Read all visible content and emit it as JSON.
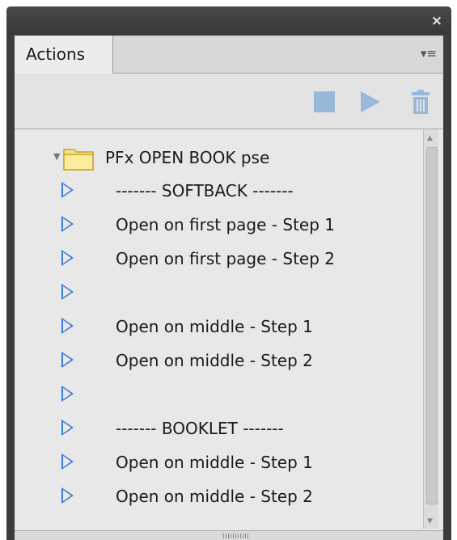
{
  "panel": {
    "tab_label": "Actions",
    "close_glyph": "×",
    "menu_glyph": "▾≡",
    "icons": {
      "close": "close-icon",
      "menu": "panel-menu-icon",
      "stop": "stop-icon",
      "play": "play-icon",
      "delete": "trash-icon"
    },
    "colors": {
      "toolbar_icon": "#98b8da",
      "action_arrow": "#3a7bd5",
      "folder_fill": "#f6e58d"
    }
  },
  "actions": {
    "set_name": "PFx OPEN BOOK pse",
    "items": [
      {
        "label": "------- SOFTBACK -------"
      },
      {
        "label": "Open on first page - Step 1"
      },
      {
        "label": "Open on first page - Step 2"
      },
      {
        "label": ""
      },
      {
        "label": "Open on middle - Step 1"
      },
      {
        "label": "Open on middle - Step 2"
      },
      {
        "label": ""
      },
      {
        "label": "------- BOOKLET -------"
      },
      {
        "label": "Open on middle - Step 1"
      },
      {
        "label": "Open on middle - Step 2"
      }
    ]
  }
}
